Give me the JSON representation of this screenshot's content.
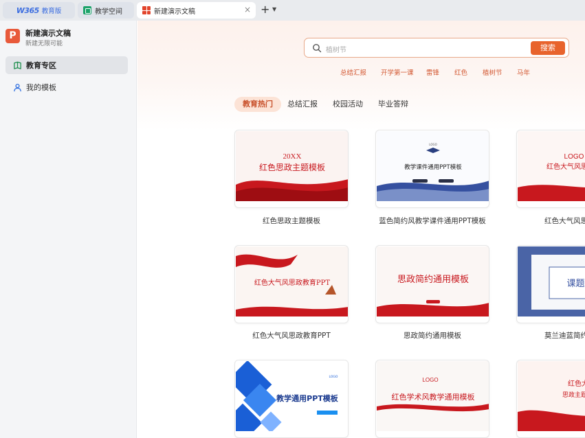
{
  "tabs": [
    {
      "brand": "W365",
      "label": "教育版"
    },
    {
      "label": "教学空间"
    },
    {
      "label": "新建演示文稿"
    }
  ],
  "tab_close": "×",
  "tab_add": "+",
  "tab_more": "⌄",
  "sidebar": {
    "app_title": "新建演示文稿",
    "app_subtitle": "新建无限可能",
    "app_icon_letter": "P",
    "items": [
      {
        "label": "教育专区",
        "icon": "book-icon",
        "active": true
      },
      {
        "label": "我的模板",
        "icon": "user-icon",
        "active": false
      }
    ]
  },
  "search": {
    "placeholder": "植树节",
    "button": "搜索"
  },
  "hot_keywords": [
    "总结汇报",
    "开学第一课",
    "雷锋",
    "红色",
    "植树节",
    "马年"
  ],
  "categories": [
    {
      "label": "教育热门",
      "active": true
    },
    {
      "label": "总结汇报",
      "active": false
    },
    {
      "label": "校园活动",
      "active": false
    },
    {
      "label": "毕业答辩",
      "active": false
    }
  ],
  "templates": [
    {
      "name": "红色思政主题模板",
      "thumb_text": [
        "20XX",
        "红色思政主题模板"
      ]
    },
    {
      "name": "蓝色简约风教学课件通用PPT模板",
      "thumb_text": [
        "LOGO",
        "教学课件通用PPT模板"
      ]
    },
    {
      "name": "红色大气风思政教",
      "thumb_text": [
        "LOGO",
        "红色大气风思政教"
      ]
    },
    {
      "name": "红色大气风思政教育PPT",
      "thumb_text": [
        "红色大气风思政教育PPT"
      ]
    },
    {
      "name": "思政简约通用模板",
      "thumb_text": [
        "思政简约通用模板"
      ]
    },
    {
      "name": "莫兰迪蓝简约风课",
      "thumb_text": [
        "课题报告书"
      ]
    },
    {
      "name": "",
      "thumb_text": [
        "LOGO",
        "教学通用PPT模板"
      ]
    },
    {
      "name": "",
      "thumb_text": [
        "LOGO",
        "红色学术风教学通用模板"
      ]
    },
    {
      "name": "",
      "thumb_text": [
        "红色大",
        "思政主题教育"
      ]
    }
  ],
  "colors": {
    "accent": "#e8632c",
    "red": "#c8181e",
    "blue": "#3550a0"
  }
}
